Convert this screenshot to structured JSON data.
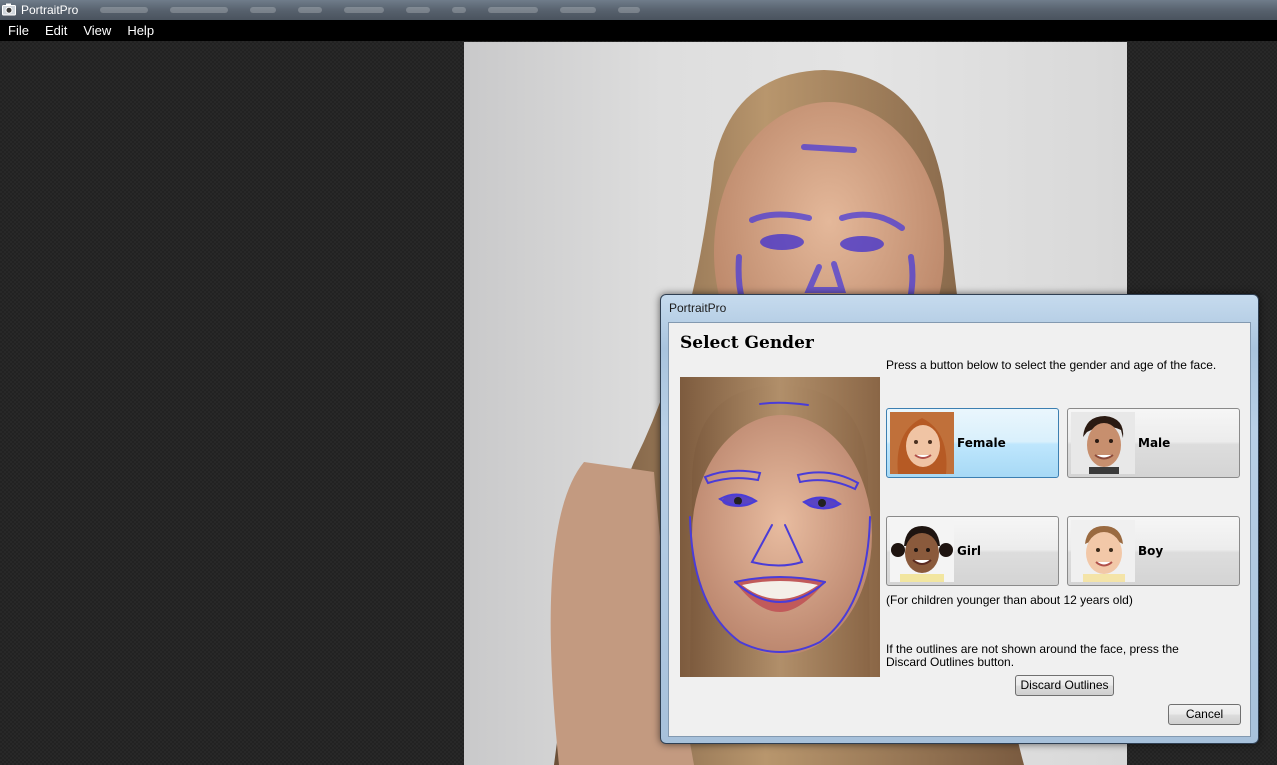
{
  "window": {
    "title": "PortraitPro"
  },
  "menu": {
    "file": "File",
    "edit": "Edit",
    "view": "View",
    "help": "Help"
  },
  "dialog": {
    "title": "PortraitPro",
    "heading": "Select Gender",
    "instruction": "Press a button below to select the gender and age of the face.",
    "buttons": {
      "female": "Female",
      "male": "Male",
      "girl": "Girl",
      "boy": "Boy"
    },
    "selected": "female",
    "children_note": "(For children younger than about 12 years old)",
    "outline_note_line1": "If the outlines are not shown around the face, press the",
    "outline_note_line2": "Discard Outlines button.",
    "discard_label": "Discard Outlines",
    "cancel_label": "Cancel"
  },
  "colors": {
    "outline": "#4a3cd8",
    "selected_button": "#bee6fd"
  }
}
